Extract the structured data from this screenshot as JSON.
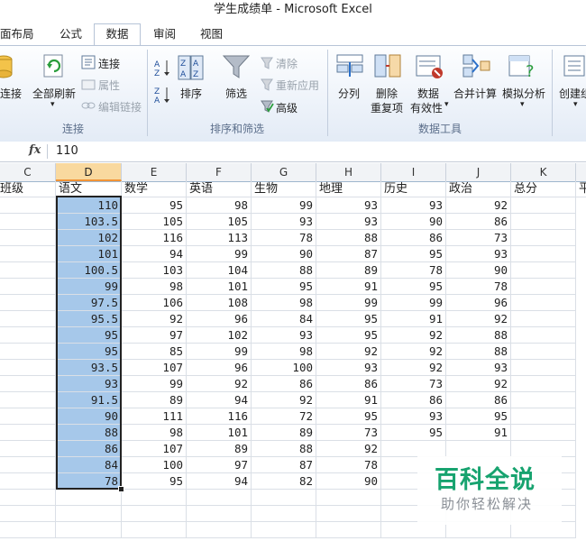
{
  "window": {
    "title": "学生成绩单 - Microsoft Excel"
  },
  "tabs": [
    {
      "label": "面布局"
    },
    {
      "label": "公式"
    },
    {
      "label": "数据",
      "active": true
    },
    {
      "label": "审阅"
    },
    {
      "label": "视图"
    }
  ],
  "ribbon": {
    "connections": {
      "connect_label": "连接",
      "refresh_all_label": "全部刷新",
      "connections_label": "连接",
      "properties_label": "属性",
      "edit_links_label": "编辑链接",
      "group_label": "连接"
    },
    "sort_filter": {
      "sort_label": "排序",
      "filter_label": "筛选",
      "clear_label": "清除",
      "reapply_label": "重新应用",
      "advanced_label": "高级",
      "group_label": "排序和筛选"
    },
    "data_tools": {
      "text_to_columns_label": "分列",
      "remove_duplicates_label": "删除",
      "remove_duplicates_label2": "重复项",
      "validation_label": "数据",
      "validation_label2": "有效性",
      "consolidate_label": "合并计算",
      "what_if_label": "模拟分析",
      "group_label": "数据工具"
    },
    "outline": {
      "create_group_label": "创建组"
    }
  },
  "formula_bar": {
    "fx_label": "fx",
    "value": "110"
  },
  "columns": [
    {
      "letter": "C"
    },
    {
      "letter": "D",
      "selected": true
    },
    {
      "letter": "E"
    },
    {
      "letter": "F"
    },
    {
      "letter": "G"
    },
    {
      "letter": "H"
    },
    {
      "letter": "I"
    },
    {
      "letter": "J"
    },
    {
      "letter": "K"
    }
  ],
  "header_row": [
    "班级",
    "语文",
    "数学",
    "英语",
    "生物",
    "地理",
    "历史",
    "政治",
    "总分",
    "平"
  ],
  "rows": [
    [
      "110",
      "95",
      "98",
      "99",
      "93",
      "93",
      "92"
    ],
    [
      "103.5",
      "105",
      "105",
      "93",
      "93",
      "90",
      "86"
    ],
    [
      "102",
      "116",
      "113",
      "78",
      "88",
      "86",
      "73"
    ],
    [
      "101",
      "94",
      "99",
      "90",
      "87",
      "95",
      "93"
    ],
    [
      "100.5",
      "103",
      "104",
      "88",
      "89",
      "78",
      "90"
    ],
    [
      "99",
      "98",
      "101",
      "95",
      "91",
      "95",
      "78"
    ],
    [
      "97.5",
      "106",
      "108",
      "98",
      "99",
      "99",
      "96"
    ],
    [
      "95.5",
      "92",
      "96",
      "84",
      "95",
      "91",
      "92"
    ],
    [
      "95",
      "97",
      "102",
      "93",
      "95",
      "92",
      "88"
    ],
    [
      "95",
      "85",
      "99",
      "98",
      "92",
      "92",
      "88"
    ],
    [
      "93.5",
      "107",
      "96",
      "100",
      "93",
      "92",
      "93"
    ],
    [
      "93",
      "99",
      "92",
      "86",
      "86",
      "73",
      "92"
    ],
    [
      "91.5",
      "89",
      "94",
      "92",
      "91",
      "86",
      "86"
    ],
    [
      "90",
      "111",
      "116",
      "72",
      "95",
      "93",
      "95"
    ],
    [
      "88",
      "98",
      "101",
      "89",
      "73",
      "95",
      "91"
    ],
    [
      "86",
      "107",
      "89",
      "88",
      "92",
      "",
      ""
    ],
    [
      "84",
      "100",
      "97",
      "87",
      "78",
      "",
      ""
    ],
    [
      "78",
      "95",
      "94",
      "82",
      "90",
      "",
      ""
    ]
  ],
  "watermark": {
    "title": "百科全说",
    "subtitle": "助你轻松解决"
  },
  "colors": {
    "selection": "#a6c8ea",
    "selected_header": "#f9d99f",
    "watermark_green": "#17a36f"
  }
}
